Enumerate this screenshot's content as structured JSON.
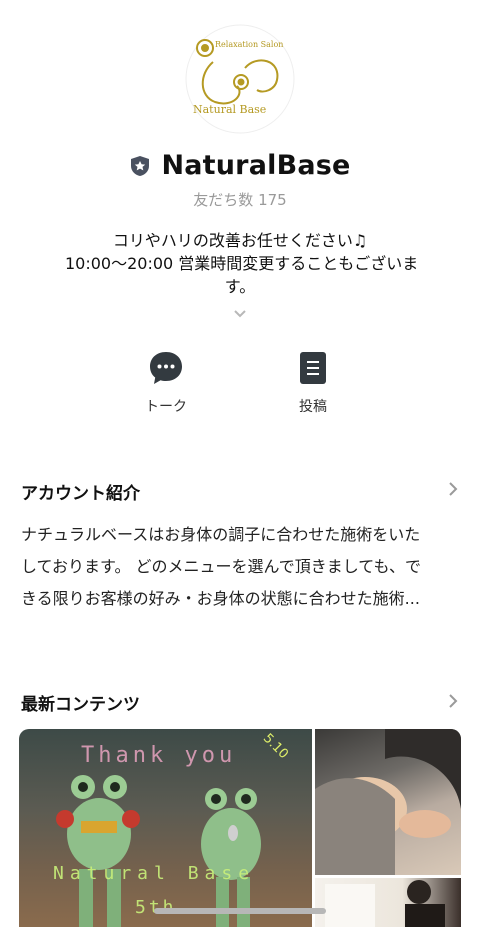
{
  "profile": {
    "logo_text_top": "Relaxation Salon",
    "logo_text_bottom": "Natural Base",
    "name": "NaturalBase",
    "friends_label": "友だち数 175",
    "status_lines": [
      "コリやハリの改善お任せください♫",
      "10:00〜20:00 営業時間変更することもございま",
      "す。"
    ]
  },
  "actions": [
    {
      "label": "トーク",
      "icon": "chat-bubble-icon"
    },
    {
      "label": "投稿",
      "icon": "post-document-icon"
    }
  ],
  "account_intro": {
    "title": "アカウント紹介",
    "lines": [
      "ナチュラルベースはお身体の調子に合わせた施術をいた",
      "しております。 どのメニューを選んで頂きましても、で",
      "きる限りお客様の好み・お身体の状態に合わせた施術..."
    ]
  },
  "latest": {
    "title": "最新コンテンツ",
    "main_image_text": {
      "thank": "Thank you",
      "date": "5.10",
      "brand": "Natural Base",
      "fifth": "5th"
    }
  },
  "colors": {
    "logo_gold": "#b59a23",
    "badge": "#4a5160",
    "icon_dark": "#333a40"
  }
}
